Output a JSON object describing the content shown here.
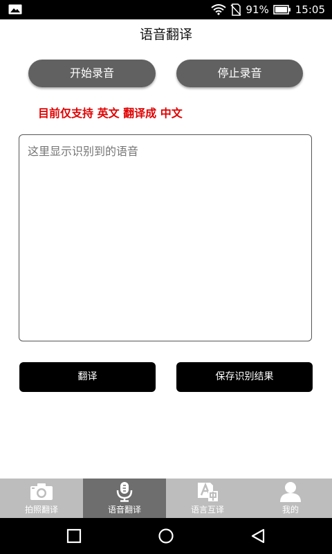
{
  "status": {
    "battery_percent": "91%",
    "time": "15:05"
  },
  "title": "语音翻译",
  "buttons": {
    "start_record": "开始录音",
    "stop_record": "停止录音",
    "translate": "翻译",
    "save_result": "保存识别结果"
  },
  "notice": "目前仅支持 英文 翻译成 中文",
  "speech_box": {
    "placeholder": "这里显示识别到的语音",
    "value": ""
  },
  "tabs": [
    {
      "label": "拍照翻译",
      "icon": "camera-icon",
      "active": false
    },
    {
      "label": "语音翻译",
      "icon": "microphone-icon",
      "active": true
    },
    {
      "label": "语言互译",
      "icon": "translate-icon",
      "active": false
    },
    {
      "label": "我的",
      "icon": "user-icon",
      "active": false
    }
  ],
  "colors": {
    "accent_red": "#e00000",
    "pill_gray": "#616161",
    "tab_bg": "#bdbdbd",
    "tab_active": "#6e6e6e"
  }
}
